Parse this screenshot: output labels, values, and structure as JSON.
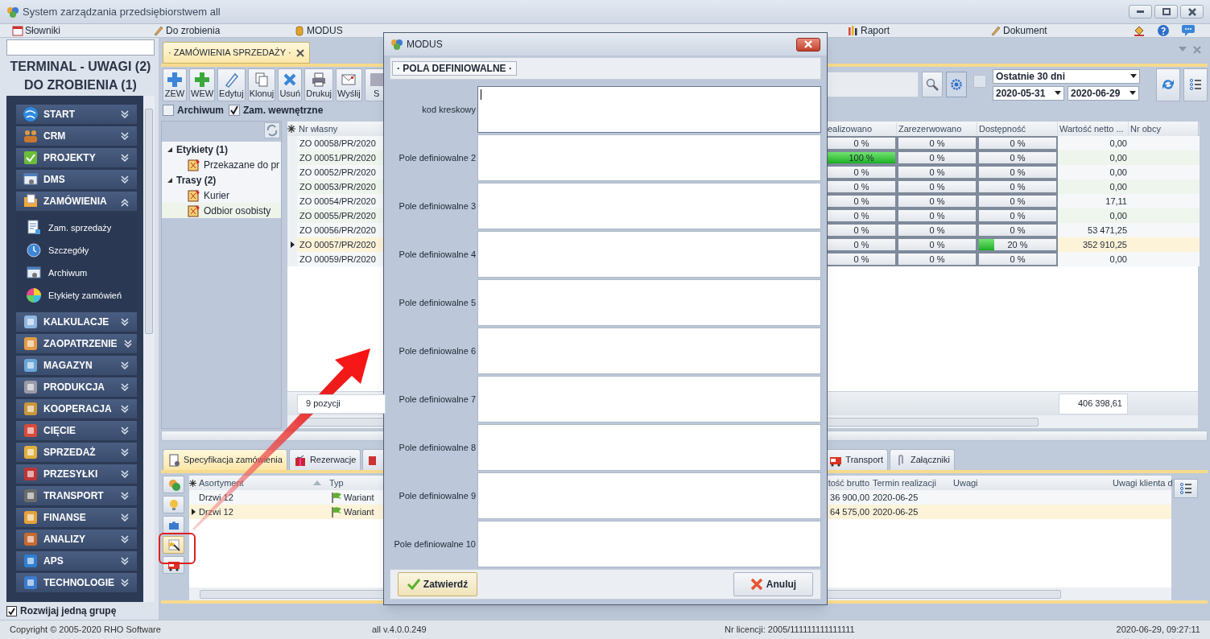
{
  "window": {
    "title": "System zarządzania przedsiębiorstwem all"
  },
  "menu_left": [
    {
      "label": "Słowniki"
    },
    {
      "label": "Do zrobienia"
    },
    {
      "label": "MODUS"
    }
  ],
  "menu_right": [
    {
      "label": "Raport"
    },
    {
      "label": "Dokument"
    }
  ],
  "sidebar": {
    "headings": [
      "TERMINAL - UWAGI (2)",
      "DO ZROBIENIA (1)"
    ],
    "groups": [
      {
        "label": "START",
        "expanded": false
      },
      {
        "label": "CRM",
        "expanded": false
      },
      {
        "label": "PROJEKTY",
        "expanded": false
      },
      {
        "label": "DMS",
        "expanded": false
      },
      {
        "label": "ZAMÓWIENIA",
        "expanded": true,
        "children": [
          {
            "label": "Zam. sprzedaży"
          },
          {
            "label": "Szczegóły"
          },
          {
            "label": "Archiwum"
          },
          {
            "label": "Etykiety zamówień"
          }
        ]
      },
      {
        "label": "KALKULACJE",
        "expanded": false
      },
      {
        "label": "ZAOPATRZENIE",
        "expanded": false
      },
      {
        "label": "MAGAZYN",
        "expanded": false
      },
      {
        "label": "PRODUKCJA",
        "expanded": false
      },
      {
        "label": "KOOPERACJA",
        "expanded": false
      },
      {
        "label": "CIĘCIE",
        "expanded": false
      },
      {
        "label": "SPRZEDAŻ",
        "expanded": false
      },
      {
        "label": "PRZESYŁKI",
        "expanded": false
      },
      {
        "label": "TRANSPORT",
        "expanded": false
      },
      {
        "label": "FINANSE",
        "expanded": false
      },
      {
        "label": "ANALIZY",
        "expanded": false
      },
      {
        "label": "APS",
        "expanded": false
      },
      {
        "label": "TECHNOLOGIE",
        "expanded": false
      }
    ],
    "single_group": {
      "label": "Rozwijaj jedną grupę",
      "checked": true
    }
  },
  "document_tab": {
    "label": "· ZAMÓWIENIA SPRZEDAŻY ·",
    "selected": true
  },
  "toolbar": [
    "ZEW",
    "WEW",
    "Edytuj",
    "Klonuj",
    "Usuń",
    "Drukuj",
    "Wyślij",
    "S"
  ],
  "quick_filter": {
    "checked": false
  },
  "period": {
    "value": "Ostatnie 30 dni",
    "from": "2020-05-31",
    "to": "2020-06-29"
  },
  "filters": [
    {
      "label": "Archiwum",
      "checked": false
    },
    {
      "label": "Zam. wewnętrzne",
      "checked": true
    }
  ],
  "tree": [
    {
      "label": "Etykiety (1)",
      "expanded": true,
      "children": [
        {
          "label": "Przekazane do pr"
        }
      ]
    },
    {
      "label": "Trasy (2)",
      "expanded": true,
      "children": [
        {
          "label": "Kurier"
        },
        {
          "label": "Odbior osobisty"
        }
      ]
    }
  ],
  "orders": {
    "columns": [
      "Nr własny",
      "ealizowano",
      "Zarezerwowano",
      "Dostępność",
      "Wartość netto ...",
      "Nr obcy"
    ],
    "rows": [
      {
        "nr": "ZO 00058/PR/2020",
        "realizowano": {
          "text": "0 %",
          "level": 0
        },
        "zarezerwowano": {
          "text": "0 %",
          "level": 0
        },
        "dostepnosc": {
          "text": "0 %",
          "level": 0
        },
        "wartosc": "0,00",
        "selected": false
      },
      {
        "nr": "ZO 00051/PR/2020",
        "realizowano": {
          "text": "100 %",
          "level": 1
        },
        "zarezerwowano": {
          "text": "0 %",
          "level": 0
        },
        "dostepnosc": {
          "text": "0 %",
          "level": 0
        },
        "wartosc": "0,00",
        "selected": false
      },
      {
        "nr": "ZO 00052/PR/2020",
        "realizowano": {
          "text": "0 %",
          "level": 0
        },
        "zarezerwowano": {
          "text": "0 %",
          "level": 0
        },
        "dostepnosc": {
          "text": "0 %",
          "level": 0
        },
        "wartosc": "0,00",
        "selected": false
      },
      {
        "nr": "ZO 00053/PR/2020",
        "realizowano": {
          "text": "0 %",
          "level": 0
        },
        "zarezerwowano": {
          "text": "0 %",
          "level": 0
        },
        "dostepnosc": {
          "text": "0 %",
          "level": 0
        },
        "wartosc": "0,00",
        "selected": false
      },
      {
        "nr": "ZO 00054/PR/2020",
        "realizowano": {
          "text": "0 %",
          "level": 0
        },
        "zarezerwowano": {
          "text": "0 %",
          "level": 0
        },
        "dostepnosc": {
          "text": "0 %",
          "level": 0
        },
        "wartosc": "17,11",
        "selected": false
      },
      {
        "nr": "ZO 00055/PR/2020",
        "realizowano": {
          "text": "0 %",
          "level": 0
        },
        "zarezerwowano": {
          "text": "0 %",
          "level": 0
        },
        "dostepnosc": {
          "text": "0 %",
          "level": 0
        },
        "wartosc": "0,00",
        "selected": false
      },
      {
        "nr": "ZO 00056/PR/2020",
        "realizowano": {
          "text": "0 %",
          "level": 0
        },
        "zarezerwowano": {
          "text": "0 %",
          "level": 0
        },
        "dostepnosc": {
          "text": "0 %",
          "level": 0
        },
        "wartosc": "53 471,25",
        "selected": false
      },
      {
        "nr": "ZO 00057/PR/2020",
        "realizowano": {
          "text": "0 %",
          "level": 0
        },
        "zarezerwowano": {
          "text": "0 %",
          "level": 0
        },
        "dostepnosc": {
          "text": "20 %",
          "level": 0.2
        },
        "wartosc": "352 910,25",
        "selected": true
      },
      {
        "nr": "ZO 00059/PR/2020",
        "realizowano": {
          "text": "0 %",
          "level": 0
        },
        "zarezerwowano": {
          "text": "0 %",
          "level": 0
        },
        "dostepnosc": {
          "text": "0 %",
          "level": 0
        },
        "wartosc": "0,00",
        "selected": false
      }
    ],
    "count": "9 pozycji",
    "total": "406 398,61"
  },
  "detail_tabs_left": [
    {
      "label": "Specyfikacja zamówienia",
      "selected": true
    },
    {
      "label": "Rezerwacje",
      "selected": false
    }
  ],
  "detail_tabs_right": [
    {
      "label": "Transport",
      "selected": false
    },
    {
      "label": "Załączniki",
      "selected": false
    }
  ],
  "side_buttons": [
    {
      "highlighted": false
    },
    {
      "highlighted": false
    },
    {
      "highlighted": false
    },
    {
      "highlighted": true
    },
    {
      "highlighted": false
    }
  ],
  "items": {
    "columns": [
      "Asortyment",
      "Typ",
      "tość brutto",
      "Termin realizacji",
      "Uwagi",
      "Uwagi klienta d"
    ],
    "rows": [
      {
        "asortyment": "Drzwi 12",
        "typ": "Wariant",
        "brutto": "36 900,00",
        "termin": "2020-06-25",
        "selected": false
      },
      {
        "asortyment": "Drzwi 12",
        "typ": "Wariant",
        "brutto": "64 575,00",
        "termin": "2020-06-25",
        "selected": true
      }
    ]
  },
  "dialog": {
    "title": "MODUS",
    "tab": "· POLA DEFINIOWALNE ·",
    "fields": [
      {
        "label": "kod kreskowy",
        "focused": true
      },
      {
        "label": "Pole definiowalne 2",
        "focused": false
      },
      {
        "label": "Pole definiowalne 3",
        "focused": false
      },
      {
        "label": "Pole definiowalne 4",
        "focused": false
      },
      {
        "label": "Pole definiowalne 5",
        "focused": false
      },
      {
        "label": "Pole definiowalne 6",
        "focused": false
      },
      {
        "label": "Pole definiowalne 7",
        "focused": false
      },
      {
        "label": "Pole definiowalne 8",
        "focused": false
      },
      {
        "label": "Pole definiowalne 9",
        "focused": false
      },
      {
        "label": "Pole definiowalne 10",
        "focused": false
      }
    ],
    "buttons": [
      "Zatwierdź",
      "Anuluj"
    ]
  },
  "status_bar": [
    "Copyright © 2005-2020 RHO Software",
    "all v.4.0.0.249",
    "Nr licencji: 2005/111111111111111",
    "2020-06-29, 09:27:11"
  ]
}
